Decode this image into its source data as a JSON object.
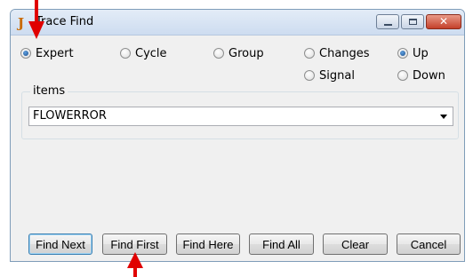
{
  "window": {
    "title": "Trace Find"
  },
  "titlebar": {
    "icon": "java-cup-icon",
    "close_glyph": "✕"
  },
  "search_type": {
    "options": [
      {
        "label": "Expert",
        "checked": true
      },
      {
        "label": "Cycle",
        "checked": false
      },
      {
        "label": "Group",
        "checked": false
      },
      {
        "label": "Changes",
        "checked": false
      },
      {
        "label": "Signal",
        "checked": false
      }
    ]
  },
  "direction": {
    "options": [
      {
        "label": "Up",
        "checked": true
      },
      {
        "label": "Down",
        "checked": false
      }
    ]
  },
  "items_group": {
    "legend": "items",
    "selected": "FLOWERROR"
  },
  "buttons": {
    "find_next": "Find Next",
    "find_first": "Find First",
    "find_here": "Find Here",
    "find_all": "Find All",
    "clear": "Clear",
    "cancel": "Cancel"
  },
  "annotation": {
    "arrow_color": "#e00000"
  }
}
